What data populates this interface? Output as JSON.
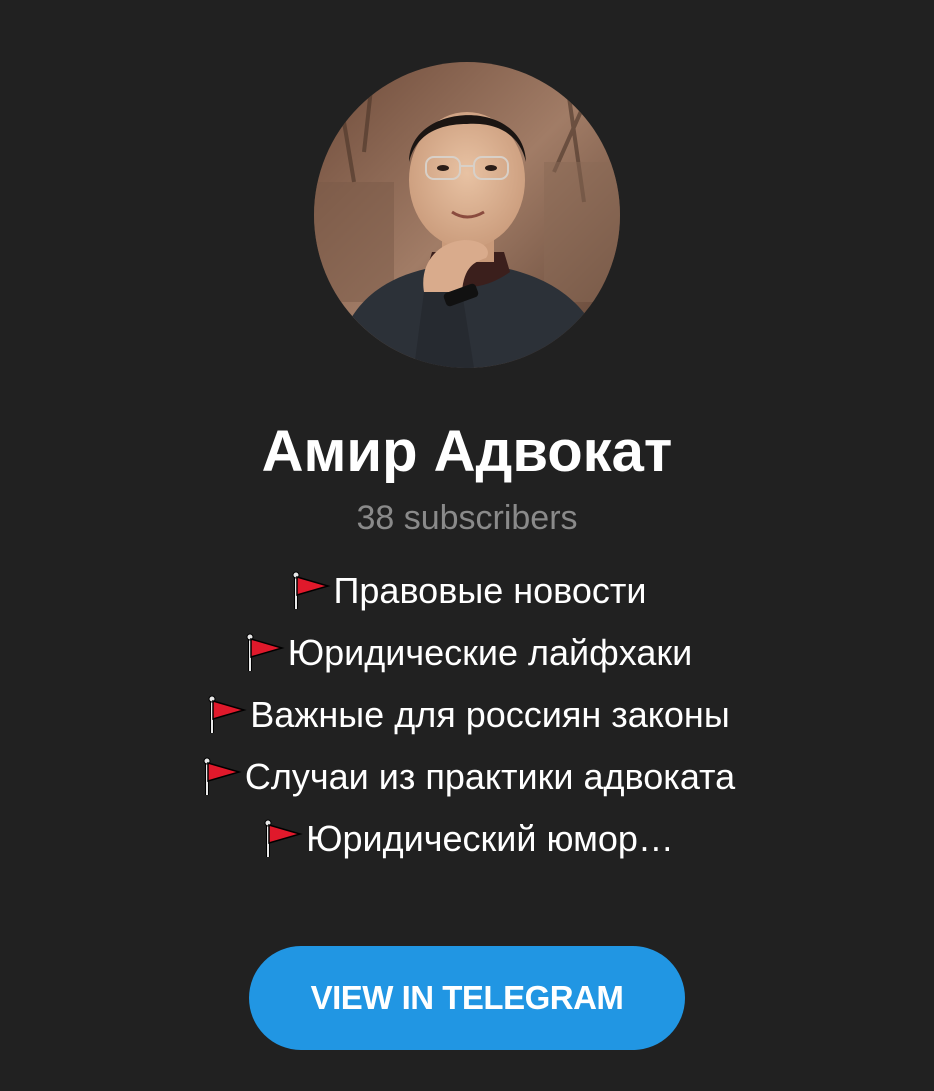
{
  "channel": {
    "title": "Амир Адвокат",
    "subscribers": "38 subscribers",
    "avatar_alt": "Амир Адвокат"
  },
  "description": {
    "lines": [
      {
        "icon": "red-flag-icon",
        "text": "Правовые новости"
      },
      {
        "icon": "red-flag-icon",
        "text": "Юридические лайфхаки"
      },
      {
        "icon": "red-flag-icon",
        "text": "Важные для россиян законы"
      },
      {
        "icon": "red-flag-icon",
        "text": "Случаи из практики адвоката"
      },
      {
        "icon": "red-flag-icon",
        "text": "Юридический юмор…"
      }
    ]
  },
  "button": {
    "label": "VIEW IN TELEGRAM"
  },
  "colors": {
    "background": "#212121",
    "title": "#ffffff",
    "subscribers": "#8a8a8a",
    "button": "#2196e3",
    "flag": "#e0192b"
  }
}
